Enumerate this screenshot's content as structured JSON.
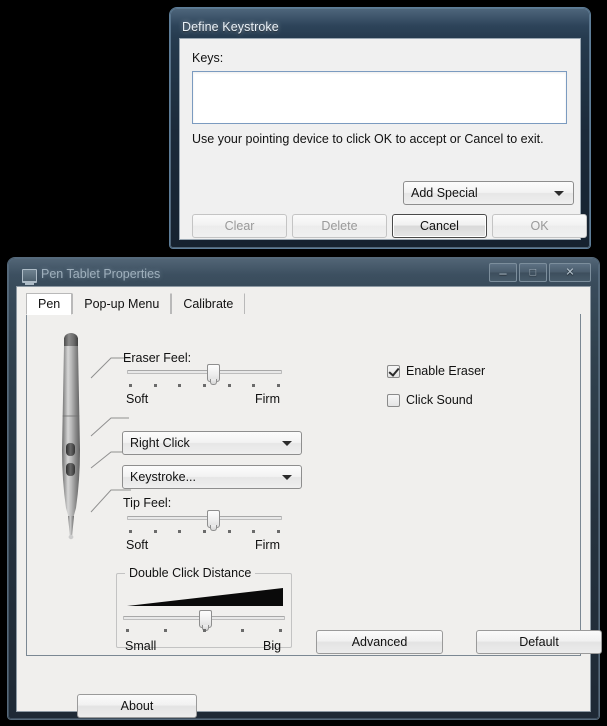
{
  "dialog": {
    "title": "Define Keystroke",
    "keys_label": "Keys:",
    "keys_value": "",
    "hint": "Use your pointing device to click OK to accept or Cancel to exit.",
    "add_special": "Add Special",
    "buttons": {
      "clear": "Clear",
      "delete": "Delete",
      "cancel": "Cancel",
      "ok": "OK"
    }
  },
  "main_window": {
    "title": "Pen Tablet Properties",
    "icon": "monitor-icon",
    "window_buttons": {
      "minimize": "–",
      "maximize": "□",
      "close": "✕"
    },
    "tabs": [
      {
        "label": "Pen",
        "selected": true
      },
      {
        "label": "Pop-up Menu",
        "selected": false
      },
      {
        "label": "Calibrate",
        "selected": false
      }
    ],
    "eraser_feel": {
      "label": "Eraser Feel:",
      "min_label": "Soft",
      "max_label": "Firm",
      "value": 55,
      "ticks": 7
    },
    "tip_feel": {
      "label": "Tip Feel:",
      "min_label": "Soft",
      "max_label": "Firm",
      "value": 55,
      "ticks": 7
    },
    "double_click_distance": {
      "label": "Double Click Distance",
      "min_label": "Small",
      "max_label": "Big",
      "value": 50,
      "ticks": 5
    },
    "side_switch_upper": "Right Click",
    "side_switch_lower": "Keystroke...",
    "checkboxes": [
      {
        "label": "Enable Eraser",
        "checked": true
      },
      {
        "label": "Click Sound",
        "checked": false
      }
    ],
    "buttons": {
      "advanced": "Advanced",
      "default": "Default",
      "about": "About"
    }
  }
}
